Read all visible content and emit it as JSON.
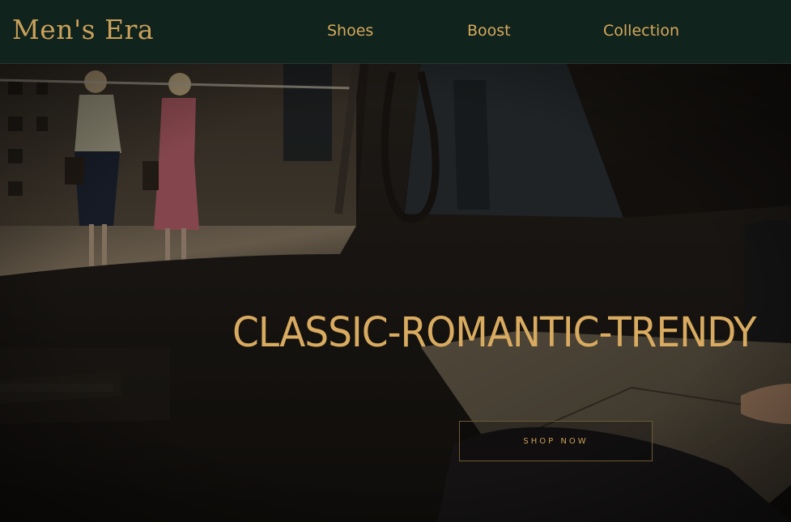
{
  "header": {
    "logo": "Men's Era",
    "nav": [
      {
        "label": "Shoes"
      },
      {
        "label": "Boost"
      },
      {
        "label": "Collection"
      }
    ]
  },
  "hero": {
    "title": "CLASSIC-ROMANTIC-TRENDY",
    "cta_label": "SHOP NOW",
    "image_subject": "vintage car interior with man reading newspaper, two women on street outside window"
  },
  "colors": {
    "header_bg": "#10231d",
    "accent_gold": "#d9ab60",
    "hero_dark": "#14110e"
  }
}
